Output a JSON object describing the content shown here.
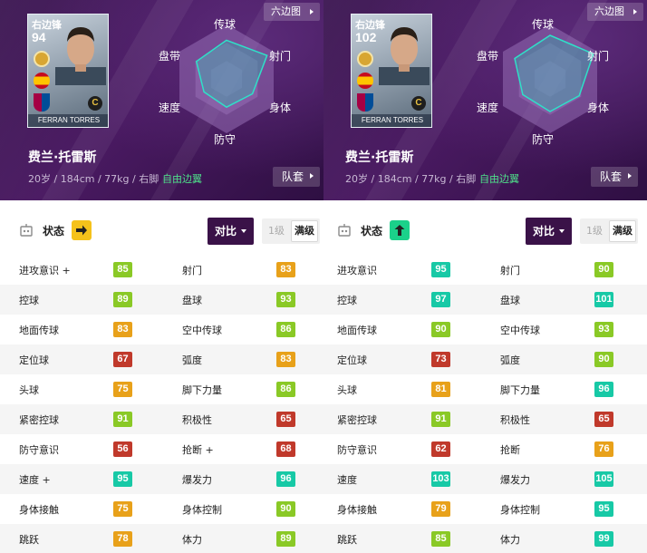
{
  "colors": {
    "cyan": "#17c9a6",
    "green": "#8ac926",
    "orange": "#e8a11a",
    "red": "#c0392b",
    "badge_yellow": "#f5c21b",
    "badge_green": "#1bd18a",
    "compare_bg": "#3a1248"
  },
  "panels": [
    {
      "card": {
        "position": "右边锋",
        "rating": "94",
        "name": "FERRAN TORRES",
        "tier": "C"
      },
      "hex_button": "六边图",
      "radar_labels": {
        "top": "传球",
        "upper_left": "盘带",
        "upper_right": "射门",
        "lower_left": "速度",
        "lower_right": "身体",
        "bottom": "防守"
      },
      "radar_values": [
        0.71,
        0.64,
        0.86,
        0.48,
        0.55,
        0.52
      ],
      "player_name": "费兰·托雷斯",
      "player_info": "20岁 / 184cm / 77kg / 右脚",
      "play_style": "自由边翼",
      "kit_button": "队套",
      "status_label": "状态",
      "status_badge": {
        "icon": "arrow-right-icon",
        "color": "#f5c21b"
      },
      "compare_button": "对比",
      "level_1": "1级",
      "level_max": "满级",
      "stats": [
        [
          {
            "name": "进攻意识 +",
            "value": "85",
            "c": "#8ac926"
          },
          {
            "name": "射门",
            "value": "83",
            "c": "#e8a11a"
          }
        ],
        [
          {
            "name": "控球",
            "value": "89",
            "c": "#8ac926"
          },
          {
            "name": "盘球",
            "value": "93",
            "c": "#8ac926"
          }
        ],
        [
          {
            "name": "地面传球",
            "value": "83",
            "c": "#e8a11a"
          },
          {
            "name": "空中传球",
            "value": "86",
            "c": "#8ac926"
          }
        ],
        [
          {
            "name": "定位球",
            "value": "67",
            "c": "#c0392b"
          },
          {
            "name": "弧度",
            "value": "83",
            "c": "#e8a11a"
          }
        ],
        [
          {
            "name": "头球",
            "value": "75",
            "c": "#e8a11a"
          },
          {
            "name": "脚下力量",
            "value": "86",
            "c": "#8ac926"
          }
        ],
        [
          {
            "name": "紧密控球",
            "value": "91",
            "c": "#8ac926"
          },
          {
            "name": "积极性",
            "value": "65",
            "c": "#c0392b"
          }
        ],
        [
          {
            "name": "防守意识",
            "value": "56",
            "c": "#c0392b"
          },
          {
            "name": "抢断 +",
            "value": "68",
            "c": "#c0392b"
          }
        ],
        [
          {
            "name": "速度 +",
            "value": "95",
            "c": "#17c9a6"
          },
          {
            "name": "爆发力",
            "value": "96",
            "c": "#17c9a6"
          }
        ],
        [
          {
            "name": "身体接触",
            "value": "75",
            "c": "#e8a11a"
          },
          {
            "name": "身体控制",
            "value": "90",
            "c": "#8ac926"
          }
        ],
        [
          {
            "name": "跳跃",
            "value": "78",
            "c": "#e8a11a"
          },
          {
            "name": "体力",
            "value": "89",
            "c": "#8ac926"
          }
        ]
      ]
    },
    {
      "card": {
        "position": "右边锋",
        "rating": "102",
        "name": "FERRAN TORRES",
        "tier": "C"
      },
      "hex_button": "六边图",
      "radar_labels": {
        "top": "传球",
        "upper_left": "盘带",
        "upper_right": "射门",
        "lower_left": "速度",
        "lower_right": "身体",
        "bottom": "防守"
      },
      "radar_values": [
        0.8,
        0.75,
        0.92,
        0.58,
        0.62,
        0.6
      ],
      "player_name": "费兰·托雷斯",
      "player_info": "20岁 / 184cm / 77kg / 右脚",
      "play_style": "自由边翼",
      "kit_button": "队套",
      "status_label": "状态",
      "status_badge": {
        "icon": "arrow-up-icon",
        "color": "#1bd18a"
      },
      "compare_button": "对比",
      "level_1": "1级",
      "level_max": "满级",
      "stats": [
        [
          {
            "name": "进攻意识",
            "value": "95",
            "c": "#17c9a6"
          },
          {
            "name": "射门",
            "value": "90",
            "c": "#8ac926"
          }
        ],
        [
          {
            "name": "控球",
            "value": "97",
            "c": "#17c9a6"
          },
          {
            "name": "盘球",
            "value": "101",
            "c": "#17c9a6"
          }
        ],
        [
          {
            "name": "地面传球",
            "value": "90",
            "c": "#8ac926"
          },
          {
            "name": "空中传球",
            "value": "93",
            "c": "#8ac926"
          }
        ],
        [
          {
            "name": "定位球",
            "value": "73",
            "c": "#c0392b"
          },
          {
            "name": "弧度",
            "value": "90",
            "c": "#8ac926"
          }
        ],
        [
          {
            "name": "头球",
            "value": "81",
            "c": "#e8a11a"
          },
          {
            "name": "脚下力量",
            "value": "96",
            "c": "#17c9a6"
          }
        ],
        [
          {
            "name": "紧密控球",
            "value": "91",
            "c": "#8ac926"
          },
          {
            "name": "积极性",
            "value": "65",
            "c": "#c0392b"
          }
        ],
        [
          {
            "name": "防守意识",
            "value": "62",
            "c": "#c0392b"
          },
          {
            "name": "抢断",
            "value": "76",
            "c": "#e8a11a"
          }
        ],
        [
          {
            "name": "速度",
            "value": "103",
            "c": "#17c9a6"
          },
          {
            "name": "爆发力",
            "value": "105",
            "c": "#17c9a6"
          }
        ],
        [
          {
            "name": "身体接触",
            "value": "79",
            "c": "#e8a11a"
          },
          {
            "name": "身体控制",
            "value": "95",
            "c": "#17c9a6"
          }
        ],
        [
          {
            "name": "跳跃",
            "value": "85",
            "c": "#8ac926"
          },
          {
            "name": "体力",
            "value": "99",
            "c": "#17c9a6"
          }
        ]
      ]
    }
  ]
}
